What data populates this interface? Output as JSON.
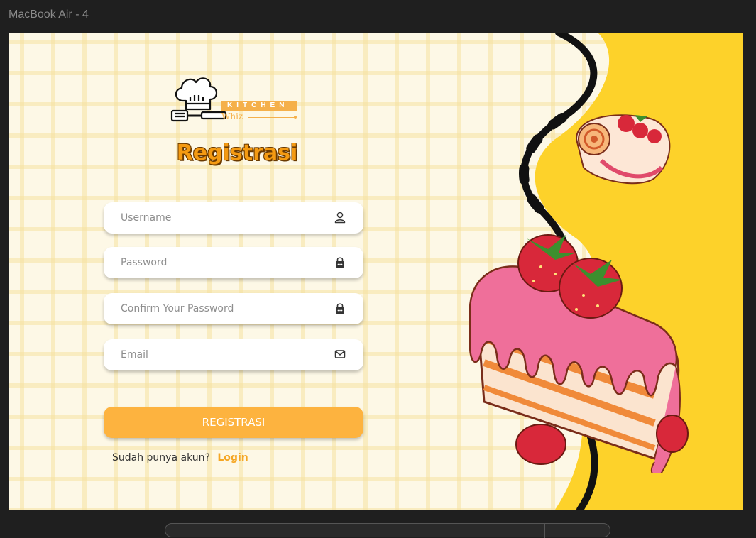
{
  "window": {
    "title": "MacBook Air - 4"
  },
  "brand": {
    "line1": "KITCHEN",
    "line2": "Whiz"
  },
  "page": {
    "title": "Registrasi"
  },
  "form": {
    "username": {
      "placeholder": "Username",
      "value": "",
      "icon": "user-icon"
    },
    "password": {
      "placeholder": "Password",
      "value": "",
      "icon": "lock-icon"
    },
    "confirm_password": {
      "placeholder": "Confirm Your Password",
      "value": "",
      "icon": "lock-icon"
    },
    "email": {
      "placeholder": "Email",
      "value": "",
      "icon": "mail-icon"
    },
    "submit_label": "REGISTRASI"
  },
  "footer": {
    "prompt": "Sudah punya akun?",
    "login_label": "Login"
  },
  "colors": {
    "accent": "#fdb33f",
    "title": "#f49a12",
    "panel_yellow": "#fdd22a",
    "background": "#fdf8e6"
  }
}
